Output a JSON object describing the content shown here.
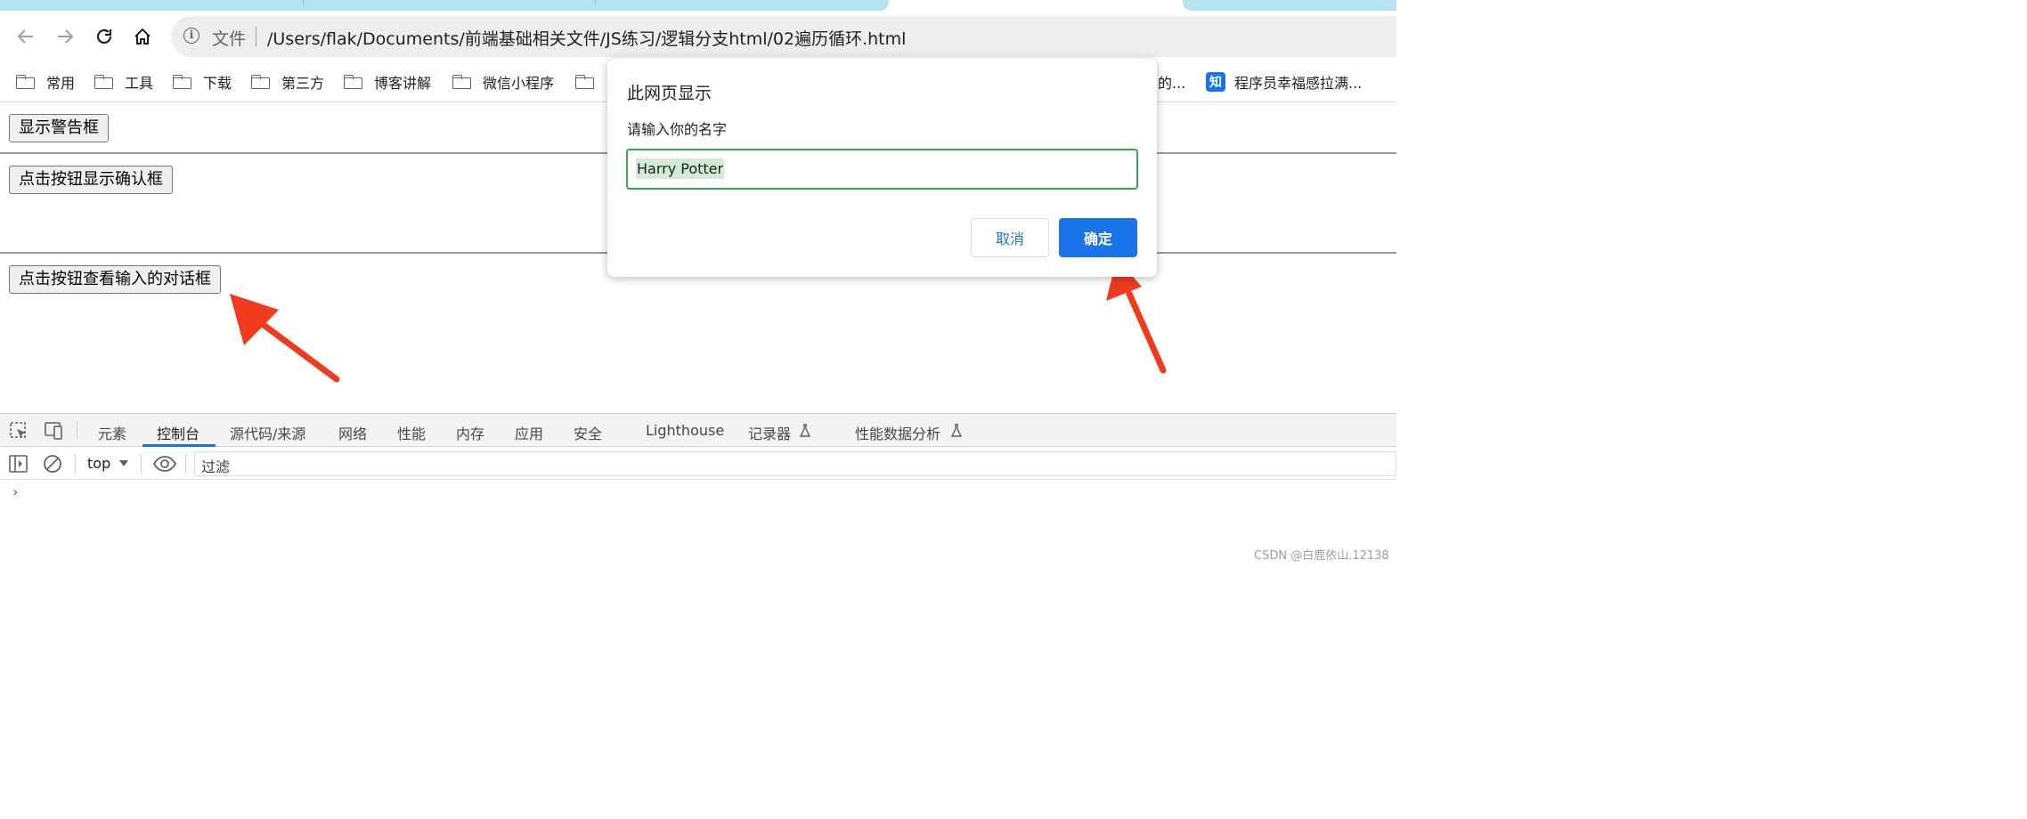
{
  "browser": {
    "nav": {
      "back_icon": "arrow-left-icon",
      "forward_icon": "arrow-right-icon",
      "reload_icon": "reload-icon",
      "home_icon": "home-icon"
    },
    "omnibox": {
      "security_label": "文件",
      "url": "/Users/flak/Documents/前端基础相关文件/JS练习/逻辑分支html/02遍历循环.html"
    },
    "bookmarks": [
      "常用",
      "工具",
      "下载",
      "第三方",
      "博客讲解",
      "微信小程序"
    ],
    "bookmark_partial_right": "的...",
    "bookmark_zhihu": {
      "badge": "知",
      "label": "程序员幸福感拉满..."
    }
  },
  "page": {
    "buttons": [
      "显示警告框",
      "点击按钮显示确认框",
      "点击按钮查看输入的对话框"
    ]
  },
  "dialog": {
    "title": "此网页显示",
    "message": "请输入你的名字",
    "input_value": "Harry Potter",
    "cancel_label": "取消",
    "ok_label": "确定"
  },
  "devtools": {
    "tabs": [
      "元素",
      "控制台",
      "源代码/来源",
      "网络",
      "性能",
      "内存",
      "应用",
      "安全",
      "Lighthouse",
      "记录器",
      "性能数据分析"
    ],
    "active_tab": "控制台",
    "context": "top",
    "filter_placeholder": "过滤",
    "prompt": "›"
  },
  "annotations": {
    "arrow_color": "#f03a1e"
  },
  "watermark": "CSDN @白鹿依山.12138"
}
